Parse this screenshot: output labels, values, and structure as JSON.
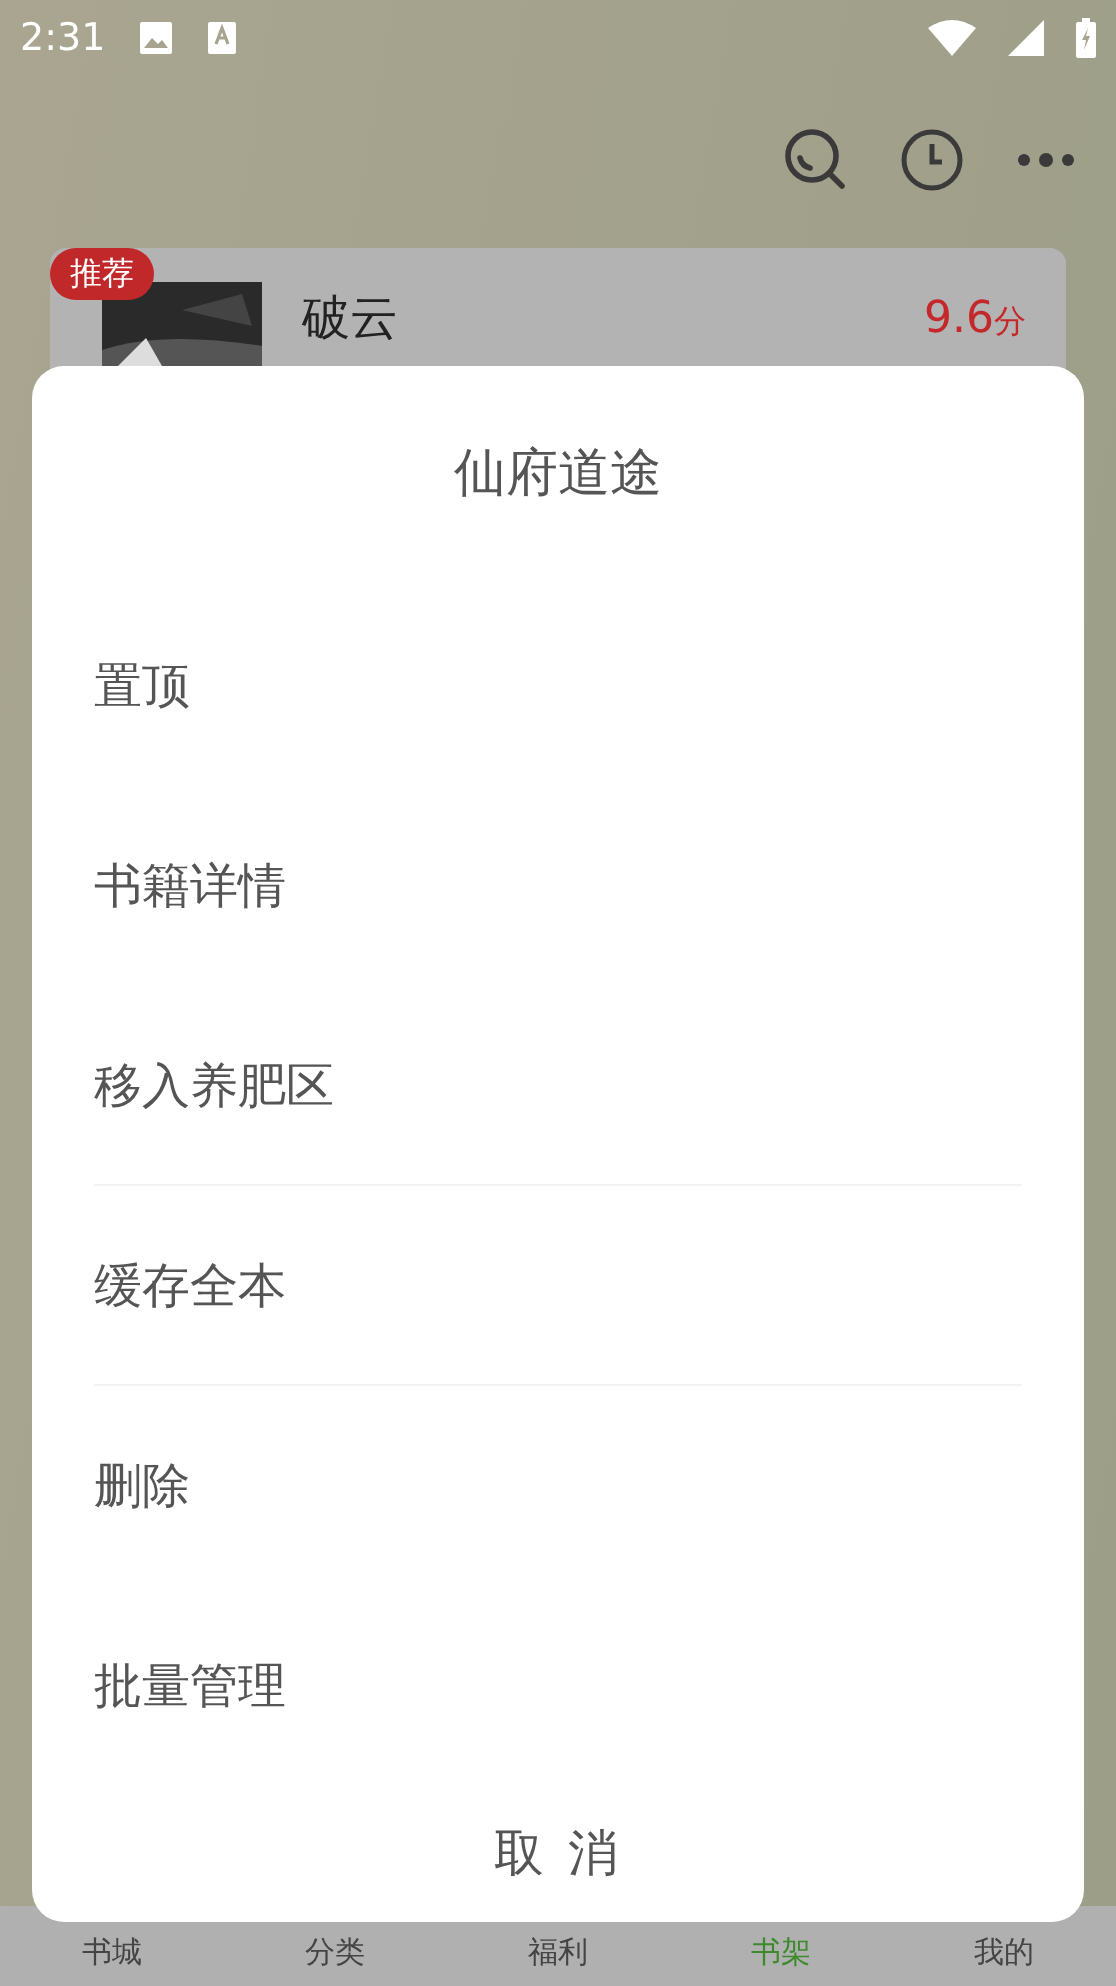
{
  "status_bar": {
    "time": "2:31"
  },
  "book": {
    "badge": "推荐",
    "title": "破云",
    "score": "9.6",
    "score_unit": "分"
  },
  "sheet": {
    "title": "仙府道途",
    "items": [
      {
        "label": "置顶",
        "divider": false
      },
      {
        "label": "书籍详情",
        "divider": false
      },
      {
        "label": "移入养肥区",
        "divider": true
      },
      {
        "label": "缓存全本",
        "divider": true
      },
      {
        "label": "删除",
        "divider": false
      },
      {
        "label": "批量管理",
        "divider": false
      }
    ],
    "cancel": "取 消"
  },
  "bottom_nav": [
    {
      "label": "书城",
      "selected": false
    },
    {
      "label": "分类",
      "selected": false
    },
    {
      "label": "福利",
      "selected": false
    },
    {
      "label": "书架",
      "selected": true
    },
    {
      "label": "我的",
      "selected": false
    }
  ]
}
